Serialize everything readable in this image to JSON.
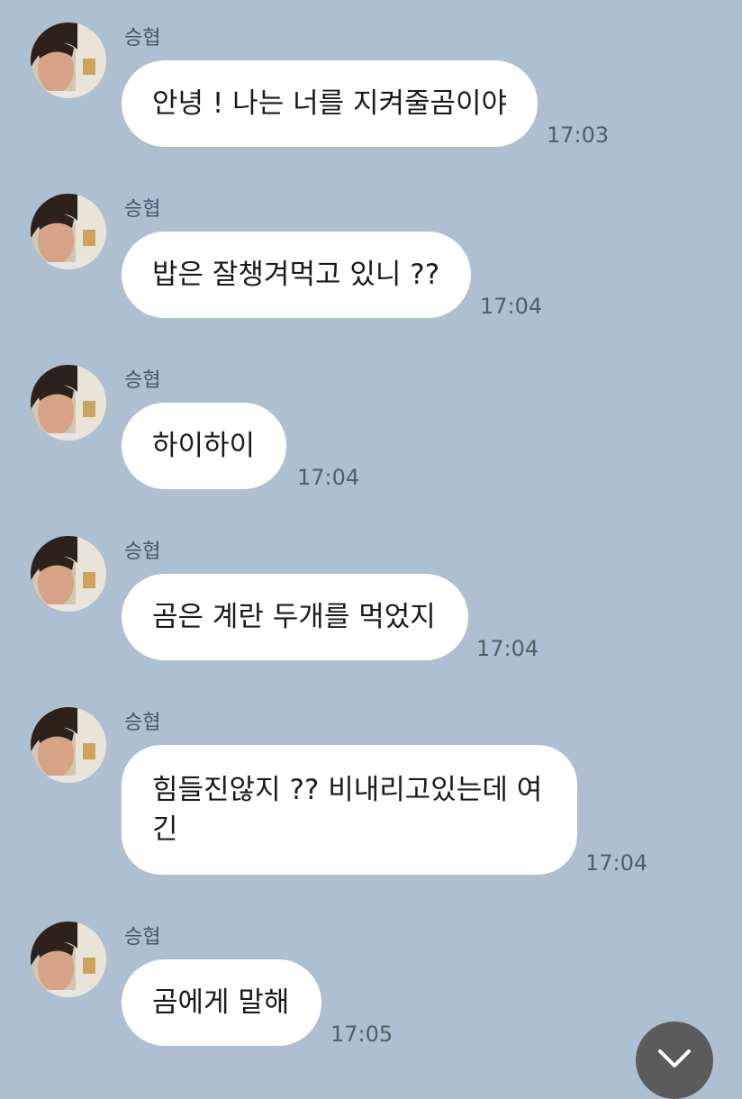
{
  "messages": [
    {
      "sender": "승협",
      "text": "안녕 ! 나는 너를 지켜줄곰이야",
      "time": "17:03"
    },
    {
      "sender": "승협",
      "text": "밥은 잘챙겨먹고 있니 ??",
      "time": "17:04"
    },
    {
      "sender": "승협",
      "text": "하이하이",
      "time": "17:04"
    },
    {
      "sender": "승협",
      "text": "곰은 계란 두개를 먹었지",
      "time": "17:04"
    },
    {
      "sender": "승협",
      "text": "힘들진않지 ?? 비내리고있는데 여긴",
      "time": "17:04"
    },
    {
      "sender": "승협",
      "text": "곰에게 말해",
      "time": "17:05"
    }
  ],
  "colors": {
    "background": "#adbfd0",
    "bubble": "#ffffff",
    "scroll_button": "#5b5b5b"
  },
  "icons": {
    "scroll_down": "chevron-down-icon",
    "avatar": "profile-photo"
  }
}
